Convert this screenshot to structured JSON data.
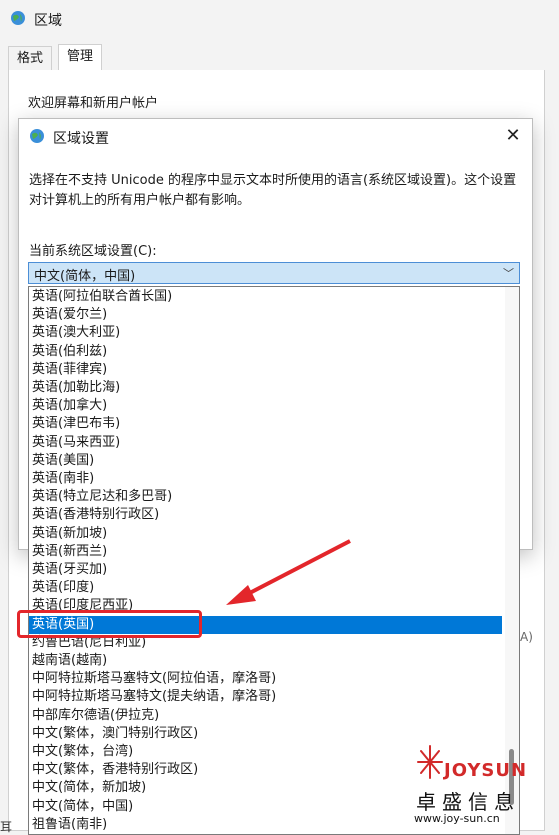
{
  "bg_window": {
    "title": "区域",
    "tabs": [
      "格式",
      "管理"
    ],
    "group_label": "欢迎屏幕和新用户帐户",
    "bottom_hint": "A)",
    "bottom_left": "耳"
  },
  "dialog": {
    "title": "区域设置",
    "close": "✕",
    "description": "选择在不支持 Unicode 的程序中显示文本时所使用的语言(系统区域设置)。这个设置对计算机上的所有用户帐户都有影响。",
    "current_label": "当前系统区域设置(C):",
    "combo_value": "中文(简体，中国)"
  },
  "list": {
    "items": [
      "英语(阿拉伯联合酋长国)",
      "英语(爱尔兰)",
      "英语(澳大利亚)",
      "英语(伯利兹)",
      "英语(菲律宾)",
      "英语(加勒比海)",
      "英语(加拿大)",
      "英语(津巴布韦)",
      "英语(马来西亚)",
      "英语(美国)",
      "英语(南非)",
      "英语(特立尼达和多巴哥)",
      "英语(香港特别行政区)",
      "英语(新加坡)",
      "英语(新西兰)",
      "英语(牙买加)",
      "英语(印度)",
      "英语(印度尼西亚)",
      "英语(英国)",
      "约鲁巴语(尼日利亚)",
      "越南语(越南)",
      "中阿特拉斯塔马塞特文(阿拉伯语，摩洛哥)",
      "中阿特拉斯塔马塞特文(提夫纳语，摩洛哥)",
      "中部库尔德语(伊拉克)",
      "中文(繁体，澳门特别行政区)",
      "中文(繁体，台湾)",
      "中文(繁体，香港特别行政区)",
      "中文(简体，新加坡)",
      "中文(简体，中国)",
      "祖鲁语(南非)"
    ],
    "selected_index": 18
  },
  "watermark": {
    "brand": "JOYSUN",
    "chinese": "卓盛信息",
    "url": "www.joy-sun.cn"
  },
  "colors": {
    "selection": "#0078d7",
    "annotation": "#e3262b"
  }
}
